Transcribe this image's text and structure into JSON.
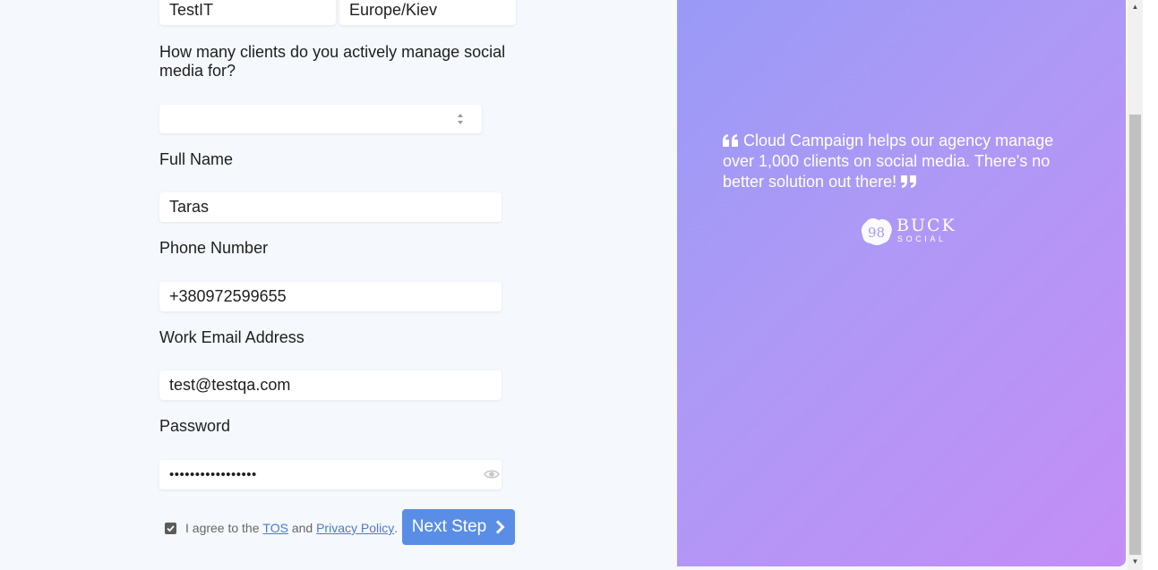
{
  "form": {
    "company_value": "TestIT",
    "timezone_value": "Europe/Kiev",
    "clients_question": "How many clients do you actively manage social media for?",
    "clients_select_value": "",
    "full_name_label": "Full Name",
    "full_name_value": "Taras",
    "phone_label": "Phone Number",
    "phone_value": "+380972599655",
    "email_label": "Work Email Address",
    "email_value": "test@testqa.com",
    "password_label": "Password",
    "password_value": "•••••••••••••••••",
    "agree_prefix": "I agree to the",
    "tos_link": "TOS",
    "agree_and": "and",
    "privacy_link": "Privacy Policy",
    "agree_suffix": ".",
    "agree_checked": true,
    "next_button": "Next Step"
  },
  "testimonial": {
    "quote": "Cloud Campaign helps our agency manage over 1,000 clients on social media. There's no better solution out there!",
    "logo_badge": "98",
    "logo_name": "BUCK",
    "logo_sub": "SOCIAL"
  },
  "colors": {
    "accent": "#5a8ee6",
    "panel_gradient_start": "#999af6",
    "panel_gradient_end": "#c38ef6",
    "page_bg": "#f5f8fc"
  },
  "icons": {
    "select": "sort-arrows-icon",
    "password": "eye-icon",
    "checkbox": "checkmark-icon",
    "next": "chevron-right-icon",
    "quote_open": "quote-open-icon",
    "quote_close": "quote-close-icon"
  }
}
